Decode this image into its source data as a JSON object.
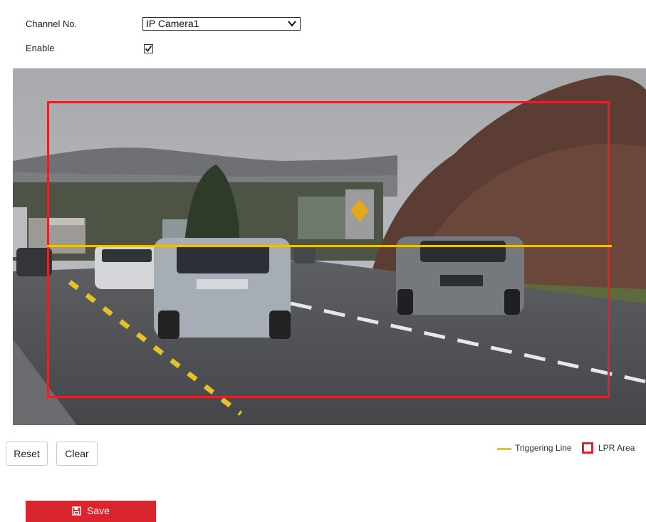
{
  "form": {
    "channel_label": "Channel No.",
    "channel_value": "IP Camera1",
    "enable_label": "Enable",
    "enable_checked": true
  },
  "video": {
    "lpr_area_color": "#e0232b",
    "trigger_line_color": "#f2c200"
  },
  "buttons": {
    "reset": "Reset",
    "clear": "Clear",
    "save": "Save"
  },
  "legend": {
    "trigger_label": "Triggering Line",
    "lpr_label": "LPR Area"
  },
  "colors": {
    "accent": "#d9262e",
    "trigger": "#f2c200",
    "lpr": "#e0232b"
  },
  "icons": {
    "dropdown": "chevron-down-icon",
    "checkbox": "checkmark-icon",
    "save": "save-disk-icon"
  }
}
